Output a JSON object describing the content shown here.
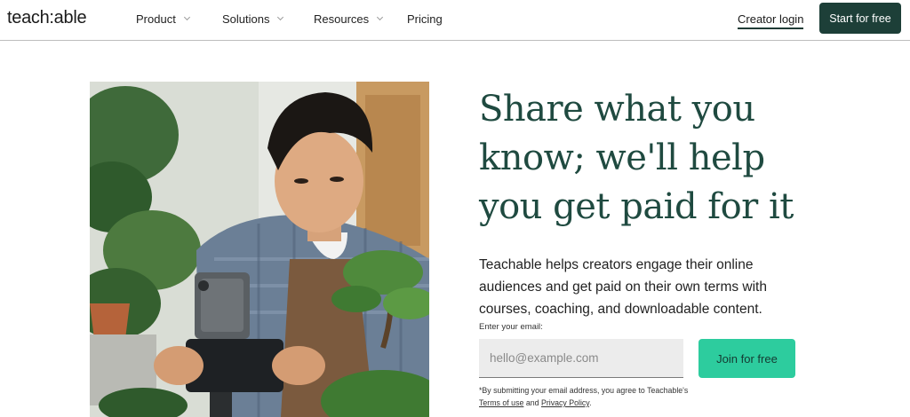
{
  "header": {
    "logo": "teach:able",
    "nav": [
      {
        "label": "Product",
        "has_dropdown": true
      },
      {
        "label": "Solutions",
        "has_dropdown": true
      },
      {
        "label": "Resources",
        "has_dropdown": true
      },
      {
        "label": "Pricing",
        "has_dropdown": false
      }
    ],
    "creator_login": "Creator login",
    "start_button": "Start for free"
  },
  "hero": {
    "headline_lines": [
      "Share what you",
      "know; we'll help",
      "you get paid for it"
    ],
    "subtext": "Teachable helps creators engage their online audiences and get paid on their own terms with courses, coaching, and downloadable content.",
    "email_label": "Enter your email:",
    "email_placeholder": "hello@example.com",
    "email_value": "",
    "join_button": "Join for free",
    "disclaimer": {
      "prefix": "*By submitting your email address, you agree to Teachable's",
      "terms_link": "Terms of use",
      "and": "and",
      "privacy_link": "Privacy Policy",
      "suffix": "."
    },
    "image_icon": "photo-creator-recording-plants"
  },
  "colors": {
    "brand_dark": "#1d3f38",
    "headline_green": "#1f4a40",
    "accent_mint": "#2dcc9e"
  }
}
